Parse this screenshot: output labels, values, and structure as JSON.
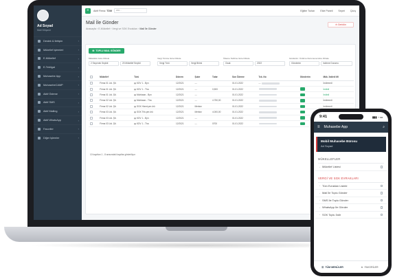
{
  "sidebar": {
    "user_name": "Ad Soyad",
    "user_role": "Mali Müşavir",
    "items": [
      {
        "label": "Destek & İletişim"
      },
      {
        "label": "Mükellef İşlemleri"
      },
      {
        "label": "E-Mükellef"
      },
      {
        "label": "E-Tebligat"
      },
      {
        "label": "Muhasebe App"
      },
      {
        "label": "MuhasebeCAMP"
      },
      {
        "label": "Aktif Ödeme"
      },
      {
        "label": "Aktif SMS"
      },
      {
        "label": "Aktif Mailing"
      },
      {
        "label": "Aktif WhatsApp"
      },
      {
        "label": "Favoriler"
      },
      {
        "label": "Diğer İşlemler"
      }
    ]
  },
  "topbar": {
    "firm_label": "Aktif Firma:",
    "firm_value": "TDM",
    "search_placeholder": "ara...",
    "links": [
      "Eğitim Turları",
      "Ekle Paneli",
      "Sepet",
      "Çıkış"
    ]
  },
  "page": {
    "title": "Mail İle Gönder",
    "breadcrumb_parts": [
      "Anasayfa",
      "E-Mükellef",
      "Vergi ve SGK Evrakları"
    ],
    "breadcrumb_current": "Mail İle Gönder",
    "back_label": "Geridön",
    "bulk_label": "TOPLU MAIL GÖNDER"
  },
  "filters": [
    {
      "label": "Mükellefe Göre Filtrele",
      "values": [
        "2 Seçenek Seçildi",
        "20 Mükellef Seçildi"
      ]
    },
    {
      "label": "Vergi Türüne Göre Filtrele",
      "values": [
        "Vergi Türü",
        "Vergi Birimi"
      ]
    },
    {
      "label": "Ödeme Tarihine Göre Filtrele",
      "values": [
        "Ocak",
        "2022"
      ]
    },
    {
      "label": "Gönderim / İndirme Durumuna Göre Filtrele",
      "values": [
        "Gönderim",
        "İndirme Durumu"
      ]
    }
  ],
  "table": {
    "headers": [
      "Mükellef",
      "Türü",
      "Dönem",
      "Şube",
      "Tutar",
      "Son Ödeme",
      "Tck. No",
      "Gönderim",
      "Mük. İndirdi Mi"
    ],
    "rows": [
      {
        "mukellef": "Firma 01 Ltd. Şti.",
        "tur": "KDV 1 - Byn",
        "donem": "12/2021",
        "sube": "---",
        "tutar": "",
        "son_odeme": "01.01.2022",
        "tck": "---",
        "send": false,
        "indirdi": "İndirmedi",
        "indirdi_green": false
      },
      {
        "mukellef": "Firma 01 Ltd. Şti.",
        "tur": "KDV 1 - Tha",
        "donem": "12/2021",
        "sube": "---",
        "tutar": "0,500",
        "son_odeme": "01.01.2022",
        "tck": "",
        "send": true,
        "indirdi": "İndirdi",
        "indirdi_green": true
      },
      {
        "mukellef": "Firma 01 Ltd. Şti.",
        "tur": "Muhtasar - Byn",
        "donem": "12/2021",
        "sube": "---",
        "tutar": "",
        "son_odeme": "01.01.2022",
        "tck": "",
        "send": true,
        "indirdi": "İndirdi",
        "indirdi_green": true
      },
      {
        "mukellef": "Firma 02 Ltd. Şti.",
        "tur": "Muhtasar - Tha",
        "donem": "12/2021",
        "sube": "---",
        "tutar": "4.750,00",
        "son_odeme": "01.01.2022",
        "tck": "",
        "send": true,
        "indirdi": "İndirmedi",
        "indirdi_green": false
      },
      {
        "mukellef": "Firma 02 Ltd. Şti.",
        "tur": "SGK Hizmt.per.ürü",
        "donem": "12/2021",
        "sube": "Merkez",
        "tutar": "",
        "son_odeme": "01.01.2022",
        "tck": "",
        "send": true,
        "indirdi": "İndirmedi",
        "indirdi_green": false
      },
      {
        "mukellef": "Firma 03 Ltd. Şti.",
        "tur": "SGK Thk.per.ürü",
        "donem": "12/2021",
        "sube": "Merkez",
        "tutar": "4.000,00",
        "son_odeme": "01.01.2022",
        "tck": "",
        "send": true,
        "indirdi": "İndirmedi",
        "indirdi_green": false
      },
      {
        "mukellef": "Firma 03 Ltd. Şti.",
        "tur": "KDV 1 - Byn",
        "donem": "12/2021",
        "sube": "---",
        "tutar": "",
        "son_odeme": "01.01.2022",
        "tck": "",
        "send": true,
        "indirdi": "İndirmedi",
        "indirdi_green": false
      },
      {
        "mukellef": "Firma 03 Ltd. Şti.",
        "tur": "KDV 1 - Tha",
        "donem": "12/2021",
        "sube": "---",
        "tutar": "0700",
        "son_odeme": "01.01.2022",
        "tck": "",
        "send": true,
        "indirdi": "İndirmedi",
        "indirdi_green": false
      }
    ],
    "footer": "10 kayıttan 1 - 8 arasındaki kayıtlar gösteriliyor"
  },
  "phone": {
    "time": "9:41",
    "app_title": "Muhasebe App",
    "office_name": "Mobil Muhasebe Bürosu",
    "user_name": "Ad Soyad",
    "section1": "MÜKELLEFLER",
    "section1_items": [
      "Mükellef Listesi"
    ],
    "section2": "VERGİ VE SGK EVRAKLARI",
    "section2_items": [
      "Tüm Evrakları Listele",
      "Mail İle Toplu Gönder",
      "SMS İle Toplu Gönder",
      "WhatsApp İle Gönder",
      "SGK Toplu İndir"
    ],
    "tabs": [
      "TÜM MENÜLER",
      "FAVORİLER"
    ]
  },
  "colors": {
    "accent": "#27a96b",
    "sidebar": "#2b3a48",
    "danger": "#d63a3a"
  }
}
